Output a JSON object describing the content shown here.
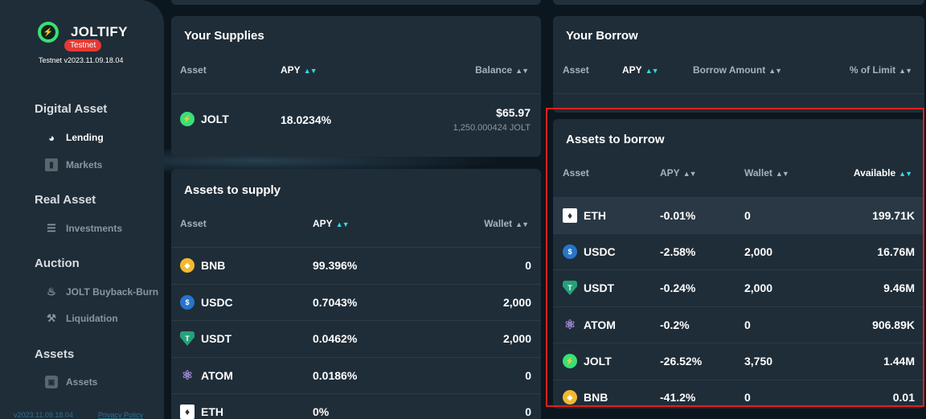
{
  "sidebar": {
    "brand": "JOLTIFY",
    "badge": "Testnet",
    "version": "Testnet v2023.11.09.18.04",
    "sections": {
      "digital": "Digital Asset",
      "real": "Real Asset",
      "auction": "Auction",
      "assets": "Assets"
    },
    "items": {
      "lending": "Lending",
      "markets": "Markets",
      "investments": "Investments",
      "buyback": "JOLT Buyback-Burn",
      "liquidation": "Liquidation",
      "assets": "Assets"
    },
    "footer": {
      "version": "v2023.11.09.18.04",
      "privacy": "Privacy Policy"
    }
  },
  "supplies": {
    "title": "Your Supplies",
    "headers": {
      "asset": "Asset",
      "apy": "APY",
      "balance": "Balance"
    },
    "row": {
      "asset": "JOLT",
      "apy": "18.0234%",
      "balance": "$65.97",
      "balance_sub": "1,250.000424 JOLT"
    }
  },
  "borrow": {
    "title": "Your Borrow",
    "headers": {
      "asset": "Asset",
      "apy": "APY",
      "amount": "Borrow Amount",
      "limit": "% of Limit"
    }
  },
  "to_supply": {
    "title": "Assets to supply",
    "headers": {
      "asset": "Asset",
      "apy": "APY",
      "wallet": "Wallet"
    },
    "rows": [
      {
        "asset": "BNB",
        "apy": "99.396%",
        "wallet": "0"
      },
      {
        "asset": "USDC",
        "apy": "0.7043%",
        "wallet": "2,000"
      },
      {
        "asset": "USDT",
        "apy": "0.0462%",
        "wallet": "2,000"
      },
      {
        "asset": "ATOM",
        "apy": "0.0186%",
        "wallet": "0"
      },
      {
        "asset": "ETH",
        "apy": "0%",
        "wallet": "0"
      }
    ]
  },
  "to_borrow": {
    "title": "Assets to borrow",
    "headers": {
      "asset": "Asset",
      "apy": "APY",
      "wallet": "Wallet",
      "available": "Available"
    },
    "rows": [
      {
        "asset": "ETH",
        "apy": "-0.01%",
        "wallet": "0",
        "available": "199.71K"
      },
      {
        "asset": "USDC",
        "apy": "-2.58%",
        "wallet": "2,000",
        "available": "16.76M"
      },
      {
        "asset": "USDT",
        "apy": "-0.24%",
        "wallet": "2,000",
        "available": "9.46M"
      },
      {
        "asset": "ATOM",
        "apy": "-0.2%",
        "wallet": "0",
        "available": "906.89K"
      },
      {
        "asset": "JOLT",
        "apy": "-26.52%",
        "wallet": "3,750",
        "available": "1.44M"
      },
      {
        "asset": "BNB",
        "apy": "-41.2%",
        "wallet": "0",
        "available": "0.01"
      }
    ]
  },
  "icons": {
    "JOLT": "jolt-coin-icon",
    "BNB": "bnb-coin-icon",
    "USDC": "usdc-coin-icon",
    "USDT": "usdt-coin-icon",
    "ATOM": "atom-coin-icon",
    "ETH": "eth-coin-icon",
    "sort": "sort-arrows-icon"
  },
  "colors": {
    "accent": "#38e07a",
    "sort_active": "#38d6e0",
    "badge": "#e53935",
    "highlight_box": "#e0201e"
  }
}
